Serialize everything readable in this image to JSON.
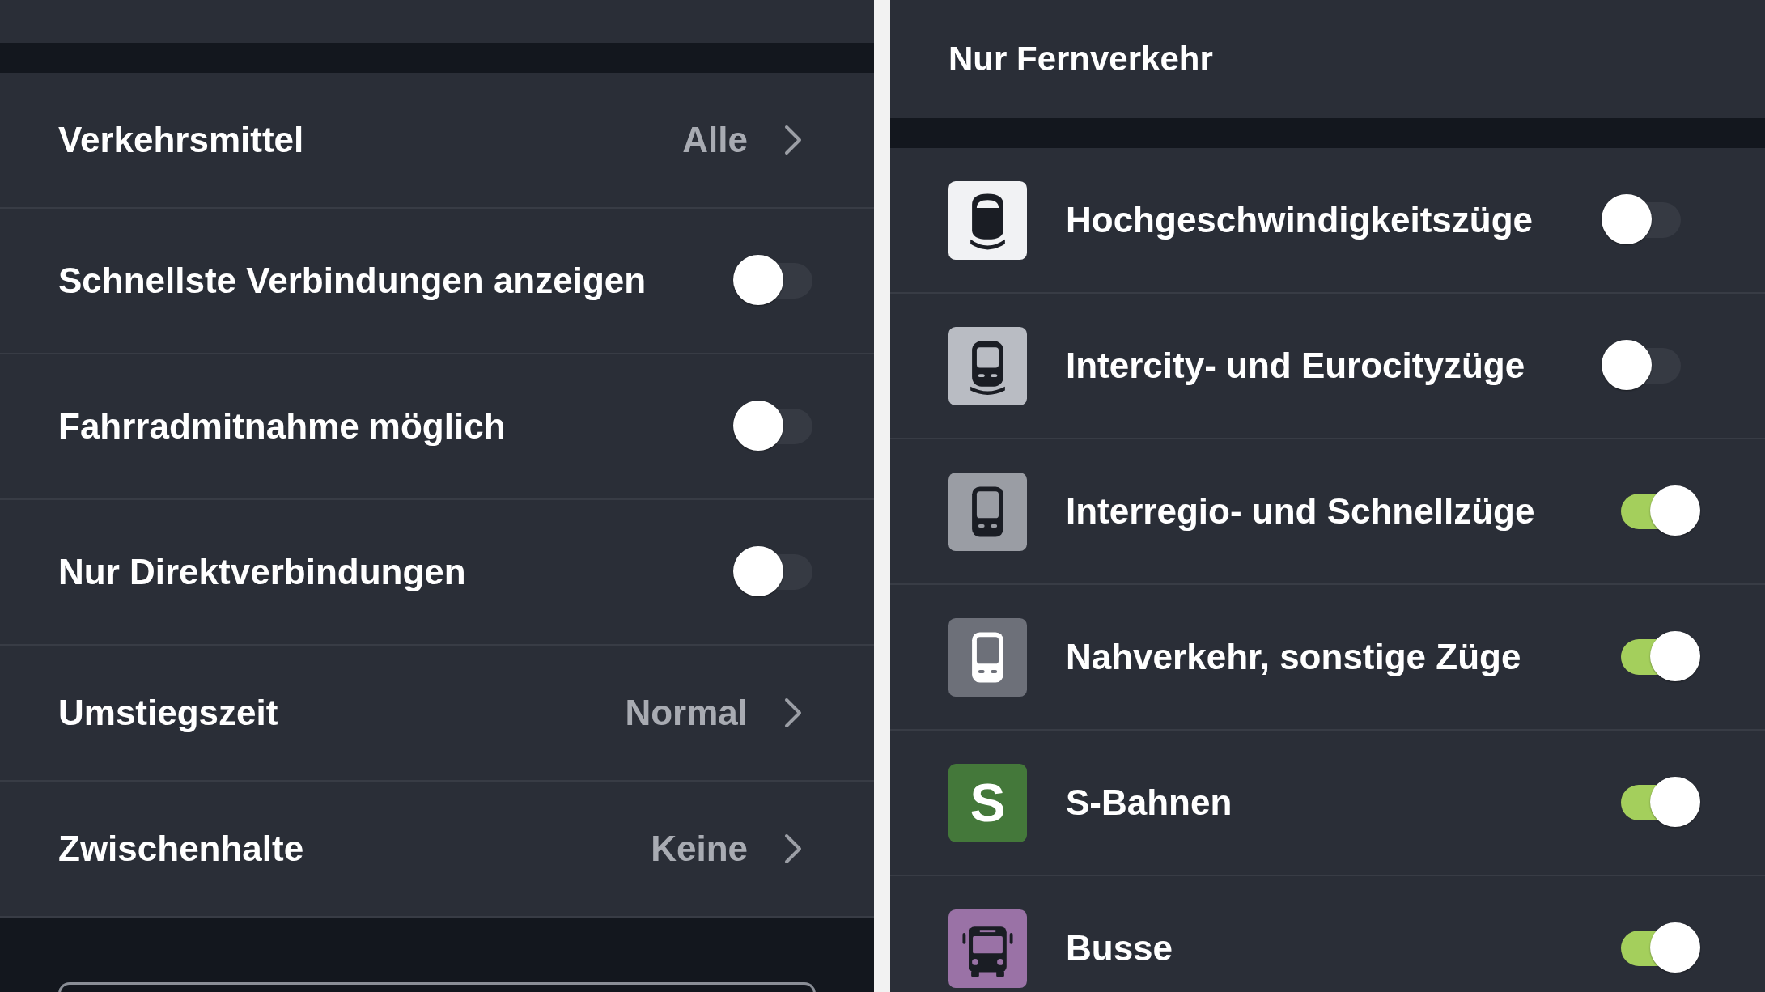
{
  "left_panel": {
    "rows": [
      {
        "kind": "select",
        "label": "Verkehrsmittel",
        "value": "Alle"
      },
      {
        "kind": "toggle",
        "label": "Schnellste Verbindungen anzeigen",
        "on": false
      },
      {
        "kind": "toggle",
        "label": "Fahrradmitnahme möglich",
        "on": false
      },
      {
        "kind": "toggle",
        "label": "Nur Direktverbindungen",
        "on": false
      },
      {
        "kind": "select",
        "label": "Umstiegszeit",
        "value": "Normal"
      },
      {
        "kind": "select",
        "label": "Zwischenhalte",
        "value": "Keine"
      }
    ]
  },
  "right_panel": {
    "title": "Nur Fernverkehr",
    "rows": [
      {
        "kind": "highspeed",
        "color": "#f1f2f4",
        "label": "Hochgeschwindigkeitszüge",
        "on": false
      },
      {
        "kind": "intercity",
        "color": "#b9bcc3",
        "label": "Intercity- und Eurocityzüge",
        "on": false
      },
      {
        "kind": "interregio",
        "color": "#9a9da4",
        "label": "Interregio- und Schnellzüge",
        "on": true
      },
      {
        "kind": "regional",
        "color": "#6d7079",
        "label": "Nahverkehr, sonstige Züge",
        "on": true
      },
      {
        "kind": "letter",
        "color": "#44783a",
        "icon_text": "S",
        "label": "S-Bahnen",
        "on": true
      },
      {
        "kind": "bus",
        "color": "#9a72a6",
        "label": "Busse",
        "on": true
      }
    ]
  }
}
